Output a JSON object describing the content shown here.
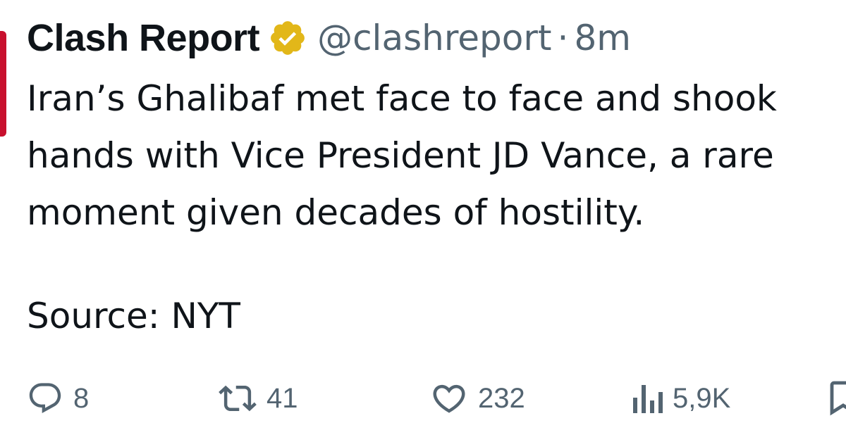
{
  "author": {
    "display_name": "Clash Report",
    "handle": "@clashreport",
    "separator": "·",
    "time": "8m",
    "verified_badge_color": "#e2b719"
  },
  "tweet": {
    "lines": [
      "Iran’s Ghalibaf met face to face and shook",
      "hands with Vice President JD Vance, a rare",
      "moment given decades of hostility."
    ],
    "source": "Source: NYT"
  },
  "actions": {
    "reply_count": "8",
    "retweet_count": "41",
    "like_count": "232",
    "views_count": "5,9K"
  },
  "icons": {
    "reply": "reply-icon",
    "retweet": "retweet-icon",
    "like": "heart-icon",
    "views": "views-icon",
    "bookmark": "bookmark-icon",
    "verified": "verified-badge-icon"
  },
  "colors": {
    "text_primary": "#0f1419",
    "text_secondary": "#536471",
    "avatar_accent": "#c8102e"
  }
}
